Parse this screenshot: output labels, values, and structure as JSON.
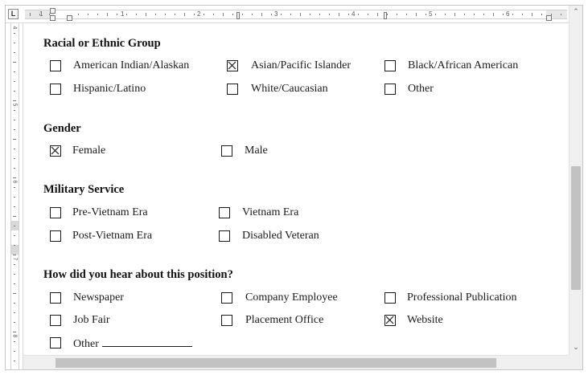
{
  "ruler": {
    "corner_label": "L",
    "numbers": [
      "1",
      "1",
      "2",
      "3",
      "4",
      "5",
      "6"
    ],
    "vertical_numbers": [
      "4",
      "5",
      "6",
      "7",
      "8"
    ]
  },
  "scrollbar": {
    "up_icon": "chevron-up-icon",
    "down_icon": "chevron-down-icon"
  },
  "sections": {
    "race": {
      "title": "Racial or Ethnic Group",
      "options": [
        {
          "label": "American Indian/Alaskan",
          "checked": false
        },
        {
          "label": "Asian/Pacific Islander",
          "checked": true
        },
        {
          "label": "Black/African American",
          "checked": false
        },
        {
          "label": "Hispanic/Latino",
          "checked": false
        },
        {
          "label": "White/Caucasian",
          "checked": false
        },
        {
          "label": "Other",
          "checked": false
        }
      ]
    },
    "gender": {
      "title": "Gender",
      "options": [
        {
          "label": "Female",
          "checked": true
        },
        {
          "label": "Male",
          "checked": false
        }
      ]
    },
    "military": {
      "title": "Military Service",
      "options": [
        {
          "label": "Pre-Vietnam Era",
          "checked": false
        },
        {
          "label": "Vietnam Era",
          "checked": false
        },
        {
          "label": "Post-Vietnam Era",
          "checked": false
        },
        {
          "label": "Disabled Veteran",
          "checked": false
        }
      ]
    },
    "source": {
      "title": "How did you hear about this position?",
      "options": [
        {
          "label": "Newspaper",
          "checked": false
        },
        {
          "label": "Company Employee",
          "checked": false
        },
        {
          "label": "Professional Publication",
          "checked": false
        },
        {
          "label": "Job Fair",
          "checked": false
        },
        {
          "label": "Placement Office",
          "checked": false
        },
        {
          "label": "Website",
          "checked": true
        },
        {
          "label": "Other",
          "checked": false
        }
      ]
    }
  }
}
